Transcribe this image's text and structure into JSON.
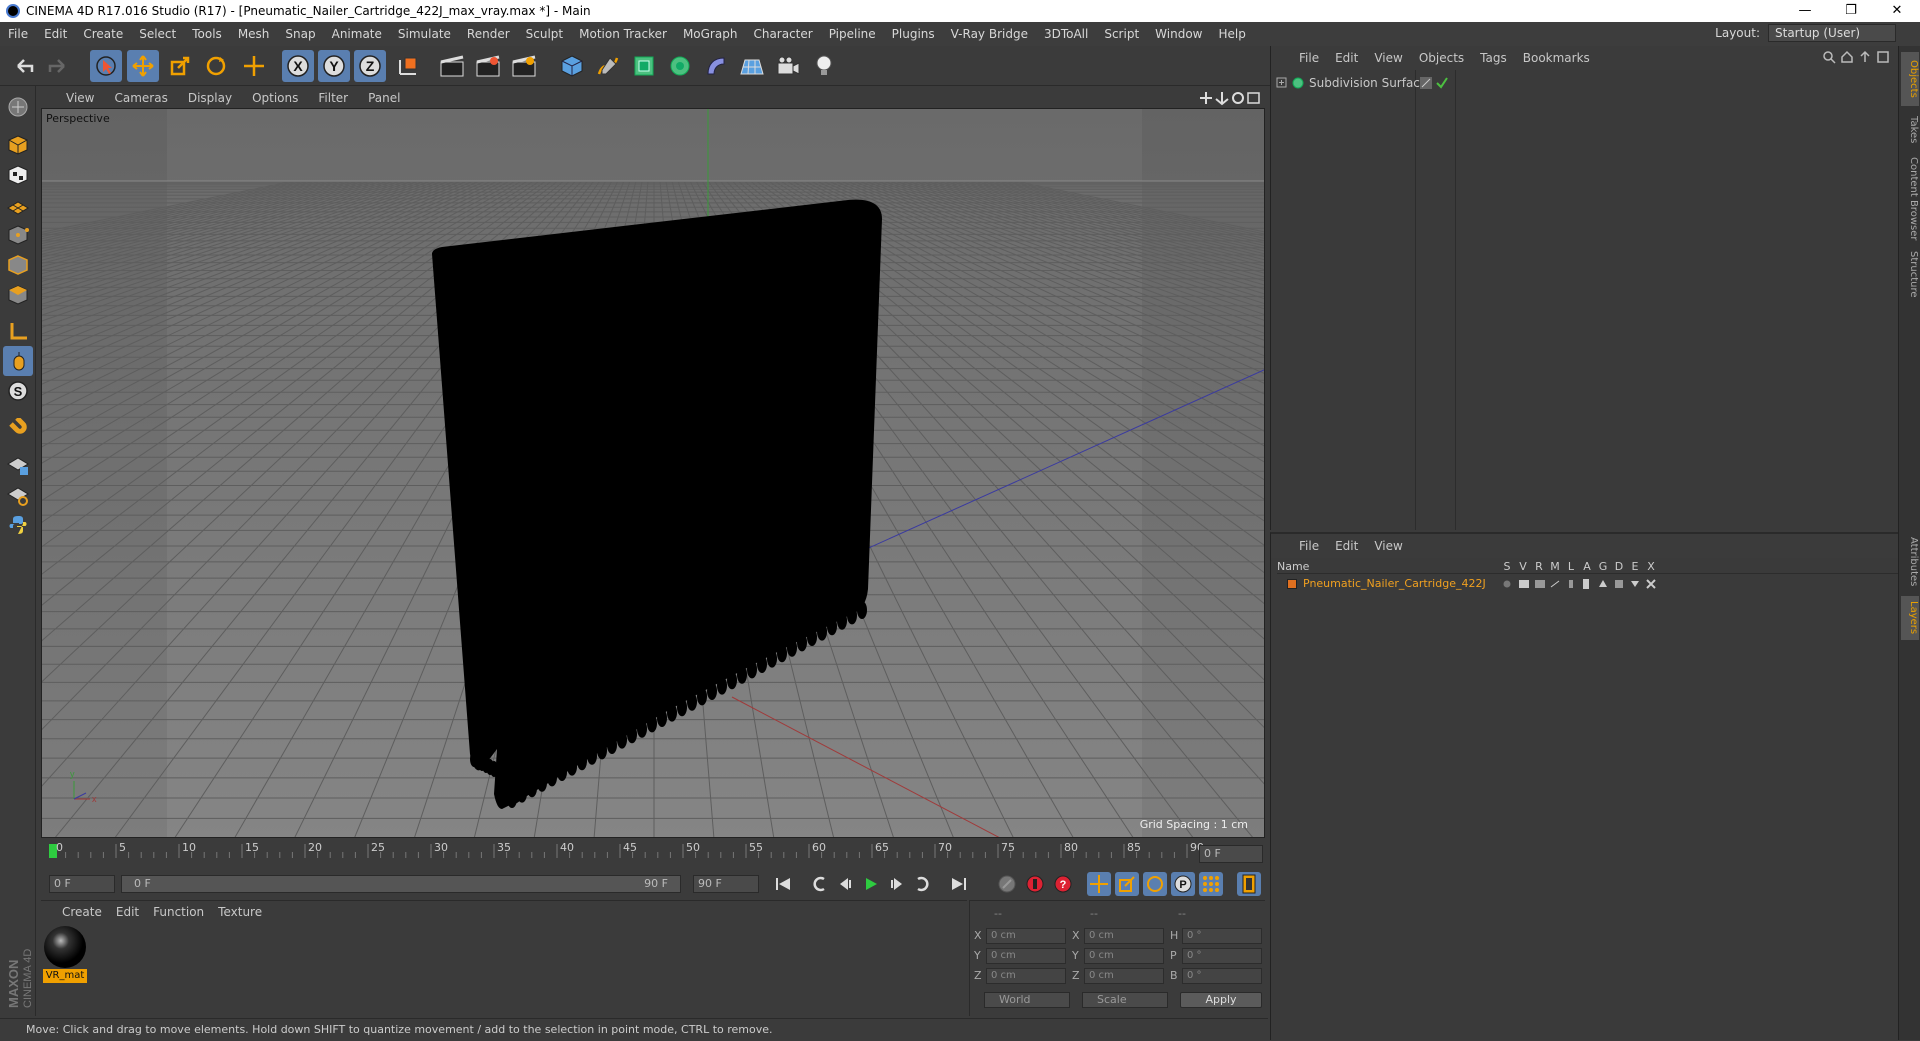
{
  "window": {
    "title": "CINEMA 4D R17.016 Studio (R17) - [Pneumatic_Nailer_Cartridge_422J_max_vray.max *] - Main",
    "minimize": "—",
    "restore": "❐",
    "close": "✕"
  },
  "menubar": {
    "items": [
      "File",
      "Edit",
      "Create",
      "Select",
      "Tools",
      "Mesh",
      "Snap",
      "Animate",
      "Simulate",
      "Render",
      "Sculpt",
      "Motion Tracker",
      "MoGraph",
      "Character",
      "Pipeline",
      "Plugins",
      "V-Ray Bridge",
      "3DToAll",
      "Script",
      "Window",
      "Help"
    ],
    "layout_label": "Layout:",
    "layout_value": "Startup (User)"
  },
  "viewport": {
    "menu": [
      "View",
      "Cameras",
      "Display",
      "Options",
      "Filter",
      "Panel"
    ],
    "camera_label": "Perspective",
    "grid_spacing": "Grid Spacing : 1 cm"
  },
  "timeline": {
    "ticks": [
      "0",
      "5",
      "10",
      "15",
      "20",
      "25",
      "30",
      "35",
      "40",
      "45",
      "50",
      "55",
      "60",
      "65",
      "70",
      "75",
      "80",
      "85",
      "90"
    ],
    "current_frame": "0 F"
  },
  "controls": {
    "start_field": "0 F",
    "range_start": "0 F",
    "range_end": "90 F",
    "end_field": "90 F"
  },
  "material_manager": {
    "menu": [
      "Create",
      "Edit",
      "Function",
      "Texture"
    ],
    "material_name": "VR_mat"
  },
  "coordinates": {
    "headers": [
      "--",
      "--",
      "--"
    ],
    "rows": [
      {
        "a1": "X",
        "v1": "0 cm",
        "a2": "X",
        "v2": "0 cm",
        "a3": "H",
        "v3": "0 °"
      },
      {
        "a1": "Y",
        "v1": "0 cm",
        "a2": "Y",
        "v2": "0 cm",
        "a3": "P",
        "v3": "0 °"
      },
      {
        "a1": "Z",
        "v1": "0 cm",
        "a2": "Z",
        "v2": "0 cm",
        "a3": "B",
        "v3": "0 °"
      }
    ],
    "space_dropdown": "World",
    "mode_dropdown": "Scale",
    "apply_label": "Apply"
  },
  "status": {
    "text": "Move: Click and drag to move elements. Hold down SHIFT to quantize movement / add to the selection in point mode, CTRL to remove."
  },
  "brand": {
    "line1": "MAXON",
    "line2": "CINEMA 4D"
  },
  "object_manager": {
    "menu": [
      "File",
      "Edit",
      "View",
      "Objects",
      "Tags",
      "Bookmarks"
    ],
    "objects": [
      {
        "name": "Subdivision Surface"
      }
    ]
  },
  "layer_manager": {
    "menu": [
      "File",
      "Edit",
      "View"
    ],
    "header_name": "Name",
    "flags": [
      "S",
      "V",
      "R",
      "M",
      "L",
      "A",
      "G",
      "D",
      "E",
      "X"
    ],
    "layers": [
      {
        "name": "Pneumatic_Nailer_Cartridge_422J",
        "color": "#e07020"
      }
    ]
  },
  "right_tabs": [
    "Objects",
    "Takes",
    "Content Browser",
    "Structure",
    "Attributes",
    "Layers"
  ],
  "colors": {
    "accent": "#5a7fb0",
    "highlight": "#e8a000",
    "layer_text": "#f0a020"
  }
}
